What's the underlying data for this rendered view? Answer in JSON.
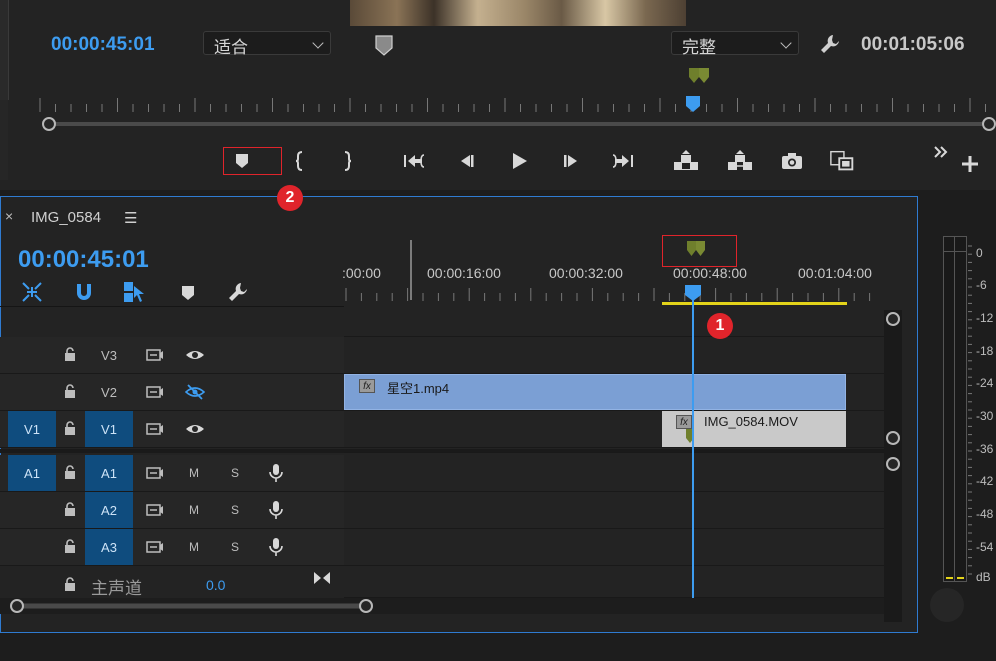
{
  "monitor": {
    "current_timecode": "00:00:45:01",
    "duration_timecode": "00:01:05:06",
    "fit_dropdown": "适合",
    "quality_dropdown": "完整"
  },
  "transport": {
    "buttons": [
      "add-marker",
      "mark-in",
      "mark-out",
      "go-to-in",
      "step-back",
      "play",
      "step-forward",
      "go-to-out",
      "lift",
      "extract",
      "export-frame",
      "insert-compare",
      "button-editor",
      "add-button"
    ]
  },
  "annotations": {
    "badge1": "1",
    "badge2": "2"
  },
  "timeline": {
    "sequence_name": "IMG_0584",
    "close": "×",
    "menu": "☰",
    "timecode": "00:00:45:01",
    "ruler_labels": [
      ":00:00",
      "00:00:16:00",
      "00:00:32:00",
      "00:00:48:00",
      "00:01:04:00"
    ],
    "tracks": {
      "v3": {
        "name": "V3"
      },
      "v2": {
        "name": "V2"
      },
      "v1": {
        "source": "V1",
        "name": "V1"
      },
      "a1": {
        "source": "A1",
        "name": "A1",
        "m": "M",
        "s": "S"
      },
      "a2": {
        "name": "A2",
        "m": "M",
        "s": "S"
      },
      "a3": {
        "name": "A3",
        "m": "M",
        "s": "S"
      }
    },
    "master": {
      "label": "主声道",
      "value": "0.0"
    },
    "clips": {
      "star": "星空1.mp4",
      "img": "IMG_0584.MOV",
      "fx": "fx"
    }
  },
  "meter": {
    "db_labels": [
      "0",
      "-6",
      "-12",
      "-18",
      "-24",
      "-30",
      "-36",
      "-42",
      "-48",
      "-54",
      "dB"
    ]
  },
  "colors": {
    "accent_blue": "#3d9cf0",
    "marker_green": "#6f7f2c",
    "annotation_red": "#e0242b",
    "work_area_yellow": "#e3d31a",
    "clip_blue": "#7b9fd4"
  }
}
